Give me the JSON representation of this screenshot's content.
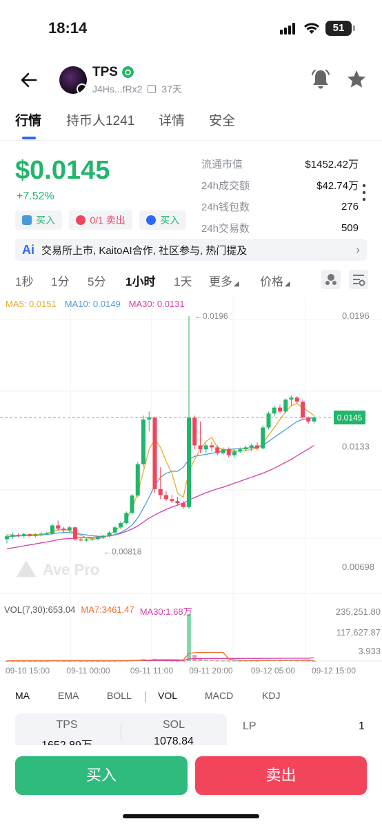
{
  "status_bar": {
    "time": "18:14",
    "battery": "51"
  },
  "header": {
    "token_name": "TPS",
    "address": "J4Hs...fRx2",
    "age": "37天",
    "icons": [
      "back-arrow-icon",
      "verified-icon",
      "copy-icon",
      "bell-icon",
      "star-icon"
    ]
  },
  "tabs": [
    "行情",
    "持币人1241",
    "详情",
    "安全"
  ],
  "price": {
    "value": "$0.0145",
    "change": "+7.52%"
  },
  "stats": [
    {
      "label": "流通市值",
      "value": "$1452.42万"
    },
    {
      "label": "24h成交额",
      "value": "$42.74万"
    },
    {
      "label": "24h钱包数",
      "value": "276"
    },
    {
      "label": "24h交易数",
      "value": "509"
    }
  ],
  "trade_chips": [
    {
      "text": "买入",
      "color": "#21b66b"
    },
    {
      "text": "0/1 卖出",
      "color": "#f2455c"
    },
    {
      "text": "买入",
      "color": "#2f66ff"
    }
  ],
  "ai_banner": {
    "badge": "Ai",
    "text": "交易所上市, KaitoAI合作, 社区参与, 热门提及"
  },
  "intervals": [
    "1秒",
    "1分",
    "5分",
    "1小时",
    "1天",
    "更多",
    "价格"
  ],
  "ma_legend": [
    {
      "text": "MA5: 0.0151",
      "color": "#e8a92a"
    },
    {
      "text": "MA10: 0.0149",
      "color": "#4a9ad8"
    },
    {
      "text": "MA30: 0.0131",
      "color": "#d63fa8"
    }
  ],
  "chart_labels": {
    "high_marker": "←0.0196",
    "low_marker": "←0.00818",
    "current_price_tag": "0.0145",
    "watermark": "Ave Pro",
    "y_ticks": [
      "0.0196",
      "0.0133",
      "0.00698"
    ]
  },
  "vol_legend": [
    {
      "text": "VOL(7,30):653.04",
      "color": "#555555"
    },
    {
      "text": "MA7:3461.47",
      "color": "#f06a2a"
    },
    {
      "text": "MA30:1.68万",
      "color": "#d63fa8"
    }
  ],
  "vol_axis": [
    "235,251.80",
    "117,627.87",
    "3.933"
  ],
  "x_ticks": [
    "09-10 15:00",
    "09-11 00:00",
    "09-11 11:00",
    "09-11 20:00",
    "09-12 05:00",
    "09-12 15:00"
  ],
  "indicator_tabs": [
    "MA",
    "EMA",
    "BOLL",
    "VOL",
    "MACD",
    "KDJ"
  ],
  "pool": {
    "token_a": {
      "symbol": "TPS",
      "amount": "1652.89万"
    },
    "token_b": {
      "symbol": "SOL",
      "amount": "1078.84"
    },
    "lp_label": "LP",
    "lp_value": "1"
  },
  "actions": {
    "buy": "买入",
    "sell": "卖出"
  },
  "colors": {
    "up": "#21b66b",
    "down": "#f2455c",
    "accent": "#2f66ff"
  },
  "chart_data": {
    "type": "candlestick",
    "title": "",
    "y_range": [
      0.00698,
      0.0196
    ],
    "candles": [
      {
        "o": 0.00839,
        "h": 0.00863,
        "l": 0.00818,
        "c": 0.00853
      },
      {
        "o": 0.00853,
        "h": 0.00872,
        "l": 0.00842,
        "c": 0.0086
      },
      {
        "o": 0.0086,
        "h": 0.00868,
        "l": 0.00849,
        "c": 0.00856
      },
      {
        "o": 0.00856,
        "h": 0.00872,
        "l": 0.00846,
        "c": 0.00864
      },
      {
        "o": 0.00864,
        "h": 0.00867,
        "l": 0.0085,
        "c": 0.00855
      },
      {
        "o": 0.00855,
        "h": 0.0087,
        "l": 0.00848,
        "c": 0.00862
      },
      {
        "o": 0.00862,
        "h": 0.00875,
        "l": 0.00852,
        "c": 0.00866
      },
      {
        "o": 0.00866,
        "h": 0.00876,
        "l": 0.0086,
        "c": 0.00867
      },
      {
        "o": 0.00867,
        "h": 0.00915,
        "l": 0.00862,
        "c": 0.00908
      },
      {
        "o": 0.00908,
        "h": 0.00932,
        "l": 0.0088,
        "c": 0.00892
      },
      {
        "o": 0.00892,
        "h": 0.009,
        "l": 0.0087,
        "c": 0.00883
      },
      {
        "o": 0.00883,
        "h": 0.00906,
        "l": 0.00872,
        "c": 0.00898
      },
      {
        "o": 0.00898,
        "h": 0.00902,
        "l": 0.0083,
        "c": 0.00838
      },
      {
        "o": 0.00838,
        "h": 0.0085,
        "l": 0.00826,
        "c": 0.00832
      },
      {
        "o": 0.00832,
        "h": 0.00848,
        "l": 0.00828,
        "c": 0.00838
      },
      {
        "o": 0.00838,
        "h": 0.0085,
        "l": 0.0083,
        "c": 0.0084
      },
      {
        "o": 0.0084,
        "h": 0.00855,
        "l": 0.00832,
        "c": 0.00847
      },
      {
        "o": 0.00847,
        "h": 0.0086,
        "l": 0.0084,
        "c": 0.00856
      },
      {
        "o": 0.00856,
        "h": 0.00878,
        "l": 0.00848,
        "c": 0.00872
      },
      {
        "o": 0.00872,
        "h": 0.00905,
        "l": 0.00866,
        "c": 0.00898
      },
      {
        "o": 0.00898,
        "h": 0.00928,
        "l": 0.0089,
        "c": 0.0092
      },
      {
        "o": 0.0092,
        "h": 0.00978,
        "l": 0.00912,
        "c": 0.0097
      },
      {
        "o": 0.0097,
        "h": 0.01065,
        "l": 0.00962,
        "c": 0.01058
      },
      {
        "o": 0.01058,
        "h": 0.01225,
        "l": 0.0105,
        "c": 0.01215
      },
      {
        "o": 0.01215,
        "h": 0.0146,
        "l": 0.012,
        "c": 0.0144
      },
      {
        "o": 0.0144,
        "h": 0.0148,
        "l": 0.0138,
        "c": 0.0145
      },
      {
        "o": 0.0145,
        "h": 0.01455,
        "l": 0.0107,
        "c": 0.0109
      },
      {
        "o": 0.0109,
        "h": 0.012,
        "l": 0.0104,
        "c": 0.0106
      },
      {
        "o": 0.0106,
        "h": 0.0108,
        "l": 0.0103,
        "c": 0.0104
      },
      {
        "o": 0.0104,
        "h": 0.0106,
        "l": 0.0102,
        "c": 0.0103
      },
      {
        "o": 0.0103,
        "h": 0.0105,
        "l": 0.0101,
        "c": 0.0102
      },
      {
        "o": 0.0102,
        "h": 0.0103,
        "l": 0.0099,
        "c": 0.01
      },
      {
        "o": 0.01,
        "h": 0.0196,
        "l": 0.0099,
        "c": 0.0145
      },
      {
        "o": 0.0145,
        "h": 0.0146,
        "l": 0.0129,
        "c": 0.0131
      },
      {
        "o": 0.0131,
        "h": 0.0143,
        "l": 0.0127,
        "c": 0.0129
      },
      {
        "o": 0.0129,
        "h": 0.0132,
        "l": 0.0127,
        "c": 0.0131
      },
      {
        "o": 0.0131,
        "h": 0.0133,
        "l": 0.0128,
        "c": 0.013
      },
      {
        "o": 0.013,
        "h": 0.0131,
        "l": 0.0126,
        "c": 0.0127
      },
      {
        "o": 0.0127,
        "h": 0.013,
        "l": 0.0126,
        "c": 0.0129
      },
      {
        "o": 0.0129,
        "h": 0.013,
        "l": 0.0125,
        "c": 0.0126
      },
      {
        "o": 0.0126,
        "h": 0.0129,
        "l": 0.0125,
        "c": 0.0128
      },
      {
        "o": 0.0128,
        "h": 0.013,
        "l": 0.0127,
        "c": 0.0129
      },
      {
        "o": 0.0129,
        "h": 0.0131,
        "l": 0.0128,
        "c": 0.013
      },
      {
        "o": 0.013,
        "h": 0.0132,
        "l": 0.0128,
        "c": 0.0131
      },
      {
        "o": 0.0131,
        "h": 0.01325,
        "l": 0.01285,
        "c": 0.01295
      },
      {
        "o": 0.01295,
        "h": 0.0141,
        "l": 0.0129,
        "c": 0.014
      },
      {
        "o": 0.014,
        "h": 0.0148,
        "l": 0.0139,
        "c": 0.0147
      },
      {
        "o": 0.0147,
        "h": 0.0151,
        "l": 0.01455,
        "c": 0.015
      },
      {
        "o": 0.015,
        "h": 0.01515,
        "l": 0.0147,
        "c": 0.0148
      },
      {
        "o": 0.0148,
        "h": 0.01545,
        "l": 0.0147,
        "c": 0.0154
      },
      {
        "o": 0.0154,
        "h": 0.0156,
        "l": 0.0151,
        "c": 0.0155
      },
      {
        "o": 0.0155,
        "h": 0.01558,
        "l": 0.0152,
        "c": 0.0153
      },
      {
        "o": 0.0153,
        "h": 0.0154,
        "l": 0.0144,
        "c": 0.0145
      },
      {
        "o": 0.0145,
        "h": 0.01455,
        "l": 0.0142,
        "c": 0.0143
      },
      {
        "o": 0.0143,
        "h": 0.0146,
        "l": 0.0142,
        "c": 0.0145
      }
    ],
    "ma5": [
      0.0086,
      0.0086,
      0.00858,
      0.00858,
      0.0086,
      0.00862,
      0.00863,
      0.00868,
      0.00878,
      0.00886,
      0.00888,
      0.00882,
      0.00868,
      0.00858,
      0.00846,
      0.0084,
      0.00841,
      0.00848,
      0.0086,
      0.0088,
      0.00905,
      0.0094,
      0.0099,
      0.0107,
      0.0118,
      0.0129,
      0.0134,
      0.013,
      0.0123,
      0.0117,
      0.0107,
      0.0105,
      0.0118,
      0.0124,
      0.0129,
      0.0133,
      0.0135,
      0.013,
      0.0129,
      0.01286,
      0.01283,
      0.0128,
      0.01284,
      0.0129,
      0.01296,
      0.0132,
      0.0136,
      0.014,
      0.0144,
      0.0148,
      0.0151,
      0.0152,
      0.015,
      0.0148,
      0.0146
    ],
    "ma10": [
      0.0085,
      0.00853,
      0.00855,
      0.00856,
      0.00857,
      0.00858,
      0.0086,
      0.00862,
      0.00866,
      0.0087,
      0.00872,
      0.00872,
      0.00868,
      0.00864,
      0.0086,
      0.00856,
      0.00854,
      0.00853,
      0.00856,
      0.00862,
      0.00872,
      0.00888,
      0.0091,
      0.00945,
      0.00995,
      0.0105,
      0.0111,
      0.0115,
      0.0117,
      0.0118,
      0.0118,
      0.012,
      0.0124,
      0.01255,
      0.0126,
      0.01265,
      0.0127,
      0.01275,
      0.01282,
      0.0129,
      0.01292,
      0.01294,
      0.01296,
      0.01298,
      0.013,
      0.0131,
      0.0133,
      0.0135,
      0.0137,
      0.0139,
      0.0141,
      0.0143,
      0.0144,
      0.01445,
      0.0145
    ],
    "ma30": [
      0.0079,
      0.00795,
      0.008,
      0.00805,
      0.0081,
      0.00815,
      0.0082,
      0.00825,
      0.0083,
      0.00836,
      0.0084,
      0.00842,
      0.00844,
      0.00846,
      0.00847,
      0.00848,
      0.0085,
      0.00852,
      0.00855,
      0.0086,
      0.00868,
      0.00878,
      0.0089,
      0.00905,
      0.00925,
      0.00945,
      0.0096,
      0.00975,
      0.00988,
      0.01,
      0.0101,
      0.0102,
      0.01035,
      0.01048,
      0.0106,
      0.01072,
      0.01082,
      0.01092,
      0.011,
      0.0111,
      0.0112,
      0.0113,
      0.0114,
      0.0115,
      0.0116,
      0.0117,
      0.01182,
      0.01195,
      0.0121,
      0.01225,
      0.0124,
      0.01258,
      0.01275,
      0.01292,
      0.0131
    ],
    "volume": [
      1500,
      1200,
      1800,
      1000,
      1400,
      900,
      1200,
      1100,
      3200,
      2500,
      1800,
      1500,
      2800,
      1400,
      1100,
      1200,
      1000,
      1300,
      1600,
      2000,
      2400,
      3000,
      3800,
      5200,
      9800,
      4200,
      11200,
      6400,
      3500,
      2800,
      2200,
      3100,
      235251.8,
      30500,
      14200,
      8200,
      5200,
      4100,
      3600,
      3000,
      2800,
      2500,
      2600,
      3000,
      2700,
      5000,
      6500,
      4200,
      3800,
      5400,
      4800,
      3500,
      4100,
      3300,
      653.04
    ],
    "vol_ma7": [
      1400,
      1400,
      1400,
      1400,
      1400,
      1400,
      1400,
      1500,
      1600,
      1700,
      1800,
      1800,
      1900,
      1800,
      1700,
      1600,
      1500,
      1400,
      1400,
      1500,
      1600,
      1800,
      2100,
      2700,
      3900,
      4800,
      6000,
      6700,
      6900,
      6700,
      6300,
      5200,
      38000,
      42000,
      42500,
      42800,
      43000,
      43200,
      43400,
      10200,
      5800,
      4400,
      3600,
      3200,
      3000,
      3200,
      3600,
      3700,
      3900,
      4200,
      4400,
      4600,
      4500,
      4300,
      3461.47
    ],
    "vol_ma30": [
      1500,
      1500,
      1500,
      1500,
      1500,
      1500,
      1500,
      1500,
      1600,
      1600,
      1700,
      1700,
      1700,
      1700,
      1700,
      1700,
      1700,
      1700,
      1700,
      1800,
      1800,
      1900,
      2000,
      2100,
      2300,
      2400,
      2700,
      2800,
      2900,
      2900,
      2900,
      3000,
      10800,
      11700,
      12100,
      12300,
      12500,
      12600,
      12700,
      12800,
      12900,
      13000,
      13100,
      13100,
      13200,
      13300,
      13400,
      13500,
      13600,
      13700,
      13800,
      13900,
      14000,
      14000,
      16800
    ]
  }
}
